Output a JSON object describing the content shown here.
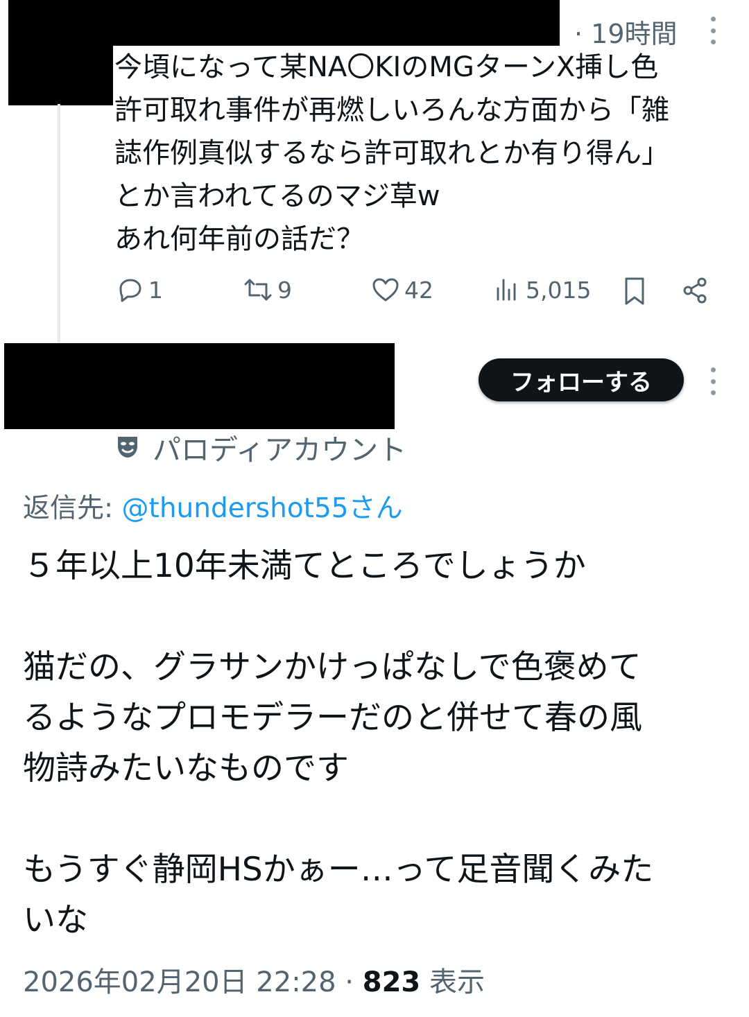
{
  "first_tweet": {
    "time": "· 19時間",
    "lines": [
      "今頃になって某NA〇KIのMGターンX挿し色",
      "許可取れ事件が再燃しいろんな方面から「雑",
      "誌作例真似するなら許可取れとか有り得ん」",
      "とか言われてるのマジ草w",
      "あれ何年前の話だ？"
    ],
    "actions": {
      "reply_icon": "reply-icon",
      "reply_count": "1",
      "retweet_icon": "retweet-icon",
      "retweet_count": "9",
      "like_icon": "heart-icon",
      "like_count": "42",
      "views_icon": "views-bar-icon",
      "views_count": "5,015",
      "bookmark_icon": "bookmark-icon",
      "share_icon": "share-icon"
    }
  },
  "second_tweet": {
    "follow_label": "フォローする",
    "badge_icon": "parody-mask-icon",
    "badge_label": "パロディアカウント",
    "reply_to_prefix": "返信先: ",
    "reply_to_handle": "@thundershot55さん",
    "lines": [
      "５年以上10年未満てところでしょうか",
      "",
      "猫だの、グラサンかけっぱなしで色褒めて",
      "るようなプロモデラーだのと併せて春の風",
      "物詩みたいなものです",
      "",
      "もうすぐ静岡HSかぁー…って足音聞くみた",
      "いな"
    ],
    "timestamp": "2026年02月20日 22:28 · ",
    "views_number": "823",
    "views_label": " 表示"
  },
  "colors": {
    "text": "#0f1419",
    "secondary": "#536471",
    "link": "#1d9bf0",
    "redaction": "#000000"
  }
}
